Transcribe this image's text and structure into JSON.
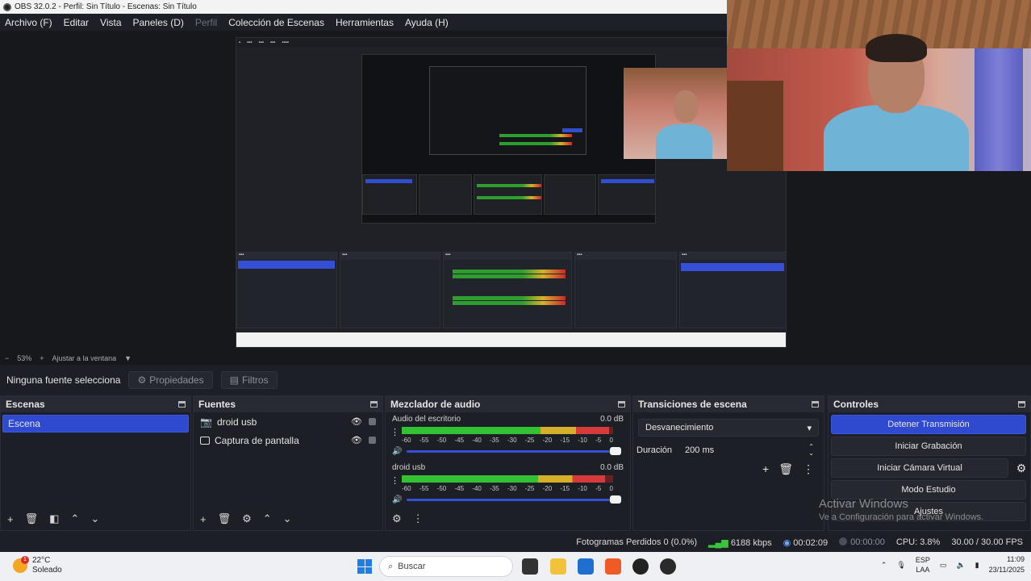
{
  "window": {
    "title": "OBS 32.0.2 - Perfil: Sin Título - Escenas: Sin Título"
  },
  "menu": [
    {
      "label": "Archivo (F)",
      "enabled": true
    },
    {
      "label": "Editar",
      "enabled": true
    },
    {
      "label": "Vista",
      "enabled": true
    },
    {
      "label": "Paneles (D)",
      "enabled": true
    },
    {
      "label": "Perfil",
      "enabled": false
    },
    {
      "label": "Colección de Escenas",
      "enabled": true
    },
    {
      "label": "Herramientas",
      "enabled": true
    },
    {
      "label": "Ayuda (H)",
      "enabled": true
    }
  ],
  "zoom": {
    "minus": "−",
    "value": "53%",
    "plus": "+",
    "fit_label": "Ajustar a la ventana"
  },
  "source_toolbar": {
    "status": "Ninguna fuente selecciona",
    "properties": "Propiedades",
    "filters": "Filtros"
  },
  "scenes": {
    "title": "Escenas",
    "items": [
      "Escena"
    ],
    "footer_icons": [
      "plus-icon",
      "trash-icon",
      "filter-icon",
      "arrow-up-icon",
      "arrow-down-icon"
    ]
  },
  "sources": {
    "title": "Fuentes",
    "items": [
      {
        "label": "droid usb",
        "icon": "camera-icon"
      },
      {
        "label": "Captura de pantalla",
        "icon": "monitor-icon"
      }
    ]
  },
  "mixer": {
    "title": "Mezclador de audio",
    "channels": [
      {
        "name": "Audio del escritorio",
        "db": "0.0 dB",
        "level": 0.98
      },
      {
        "name": "droid usb",
        "db": "0.0 dB",
        "level": 0.96
      }
    ],
    "ticks": [
      "-60",
      "-55",
      "-50",
      "-45",
      "-40",
      "-35",
      "-30",
      "-25",
      "-20",
      "-15",
      "-10",
      "-5",
      "0"
    ]
  },
  "transitions": {
    "title": "Transiciones de escena",
    "selected": "Desvanecimiento",
    "duration_label": "Duración",
    "duration_value": "200 ms"
  },
  "controls": {
    "title": "Controles",
    "stop_stream": "Detener Transmisión",
    "start_recording": "Iniciar Grabación",
    "start_virtual_cam": "Iniciar Cámara Virtual",
    "studio_mode": "Modo Estudio",
    "settings": "Ajustes"
  },
  "watermark": {
    "line1": "Activar Windows",
    "line2": "Ve a Configuración para activar Windows."
  },
  "status": {
    "dropped": "Fotogramas Perdidos 0 (0.0%)",
    "bitrate": "6188 kbps",
    "stream_time": "00:02:09",
    "rec_time": "00:00:00",
    "cpu": "CPU: 3.8%",
    "fps": "30.00 / 30.00 FPS"
  },
  "taskbar": {
    "weather_temp": "22°C",
    "weather_desc": "Soleado",
    "weather_badge": "1",
    "search_placeholder": "Buscar",
    "lang1": "ESP",
    "lang2": "LAA",
    "time": "11:09",
    "date": "23/11/2025"
  }
}
